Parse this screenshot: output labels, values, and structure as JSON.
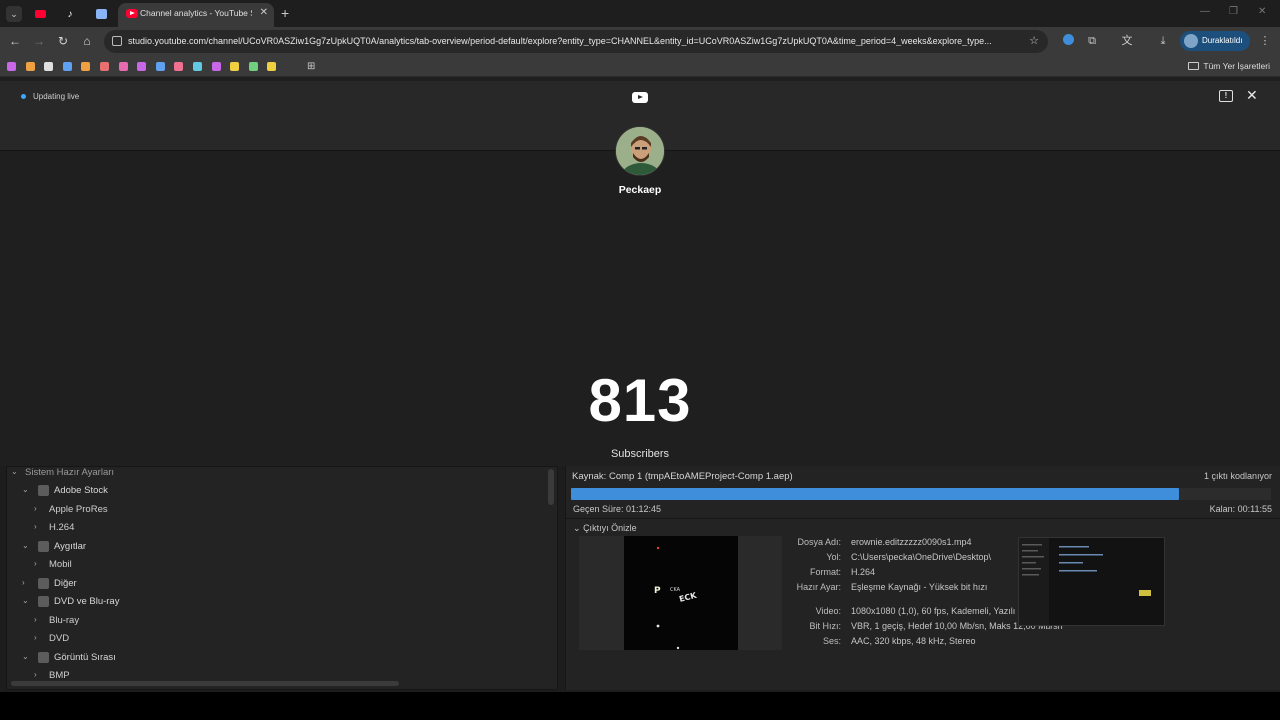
{
  "browser": {
    "tab_menu_icon": "chevron-down-icon",
    "pinned_tabs": [
      {
        "icon": "youtube-icon",
        "color": "#ff0033"
      },
      {
        "icon": "tiktok-icon",
        "color": "#ffffff"
      },
      {
        "icon": "translate-icon",
        "color": "#8ab4f8"
      }
    ],
    "active_tab": {
      "title": "Channel analytics - YouTube St",
      "favicon": "youtube-studio-icon"
    },
    "url": "studio.youtube.com/channel/UCoVR0ASZiw1Gg7zUpkUQT0A/analytics/tab-overview/period-default/explore?entity_type=CHANNEL&entity_id=UCoVR0ASZiw1Gg7zUpkUQT0A&time_period=4_weeks&explore_type...",
    "profile_label": "Duraklatıldı",
    "all_bookmarks_label": "Tüm Yer İşaretleri",
    "bookmark_colors": [
      "#c868e8",
      "#f0a040",
      "#e0e0e0",
      "#60a0f0",
      "#f0a040",
      "#e87070",
      "#e86ab0",
      "#c868e8",
      "#60a0f0",
      "#f07090",
      "#60c8e0",
      "#c868e8",
      "#f0d040",
      "#70d080",
      "#f0d040"
    ]
  },
  "studio": {
    "live_status": "Updating live",
    "channel_name": "Peckaep",
    "subscriber_count": "813",
    "subscriber_label": "Subscribers",
    "accent": "#3ea6ff"
  },
  "encoder": {
    "preset_header": "Sistem Hazır Ayarları",
    "presets": [
      {
        "label": "Adobe Stock",
        "level": 1,
        "expanded": true,
        "icon": "adobe-stock-icon"
      },
      {
        "label": "Apple ProRes",
        "level": 2,
        "expanded": false
      },
      {
        "label": "H.264",
        "level": 2,
        "expanded": false
      },
      {
        "label": "Aygıtlar",
        "level": 1,
        "expanded": true,
        "icon": "mobile-device-icon"
      },
      {
        "label": "Mobil",
        "level": 2,
        "expanded": false
      },
      {
        "label": "Diğer",
        "level": 1,
        "expanded": false,
        "icon": "monitor-icon"
      },
      {
        "label": "DVD ve Blu-ray",
        "level": 1,
        "expanded": true,
        "icon": "disc-icon"
      },
      {
        "label": "Blu-ray",
        "level": 2,
        "expanded": false
      },
      {
        "label": "DVD",
        "level": 2,
        "expanded": false
      },
      {
        "label": "Görüntü Sırası",
        "level": 1,
        "expanded": true,
        "icon": "image-sequence-icon"
      },
      {
        "label": "BMP",
        "level": 2,
        "expanded": false
      }
    ],
    "source": "Kaynak: Comp 1 (tmpAEtoAMEProject-Comp 1.aep)",
    "encode_count": "1 çıktı kodlanıyor",
    "progress_fraction": 0.868,
    "progress_color": "#3f8edb",
    "elapsed": "Geçen Süre: 01:12:45",
    "remaining": "Kalan: 00:11:55",
    "preview_label": "Çıktıyı Önizle",
    "info": [
      {
        "key": "Dosya Adı:",
        "value": "erownie.editzzzzz0090s1.mp4"
      },
      {
        "key": "Yol:",
        "value": "C:\\Users\\pecka\\OneDrive\\Desktop\\"
      },
      {
        "key": "Format:",
        "value": "H.264"
      },
      {
        "key": "Hazır Ayar:",
        "value": "Eşleşme Kaynağı - Yüksek bit hızı"
      },
      {
        "key": "Video:",
        "value": "1080x1080 (1,0), 60 fps, Kademeli, Yazılı"
      },
      {
        "key": "Bit Hızı:",
        "value": "VBR, 1 geçiş, Hedef 10,00 Mb/sn, Maks 12,00 Mb/sn"
      },
      {
        "key": "Ses:",
        "value": "AAC, 320 kbps, 48 kHz, Stereo"
      }
    ]
  }
}
